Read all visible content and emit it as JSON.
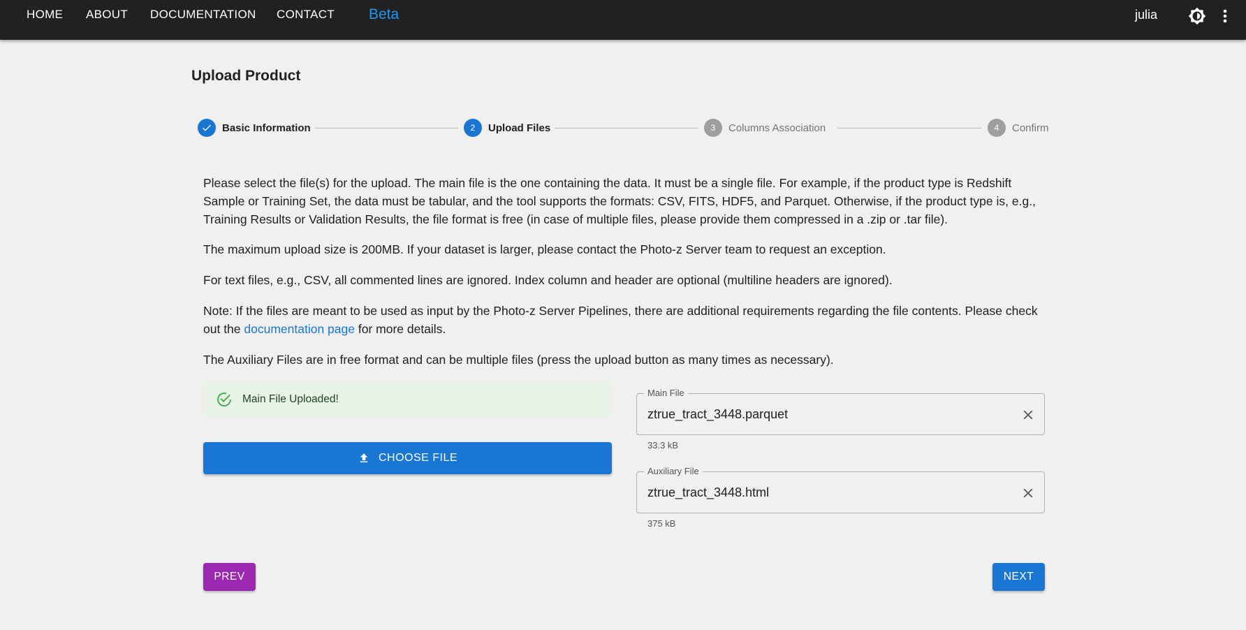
{
  "nav": {
    "items": [
      "HOME",
      "ABOUT",
      "DOCUMENTATION",
      "CONTACT"
    ],
    "beta_label": "Beta",
    "user": "julia",
    "icons": {
      "theme": "brightness-icon",
      "menu": "more-vert-icon"
    }
  },
  "page": {
    "title": "Upload Product"
  },
  "stepper": {
    "steps": [
      {
        "number": "1",
        "label": "Basic Information",
        "state": "completed"
      },
      {
        "number": "2",
        "label": "Upload Files",
        "state": "active"
      },
      {
        "number": "3",
        "label": "Columns Association",
        "state": "inactive"
      },
      {
        "number": "4",
        "label": "Confirm",
        "state": "inactive"
      }
    ],
    "colors": {
      "active": "#1976d2",
      "inactive": "#9e9e9e"
    }
  },
  "content": {
    "p1": "Please select the file(s) for the upload. The main file is the one containing the data. It must be a single file. For example, if the product type is Redshift Sample or Training Set, the data must be tabular, and the tool supports the formats: CSV, FITS, HDF5, and Parquet. Otherwise, if the product type is, e.g., Training Results or Validation Results, the file format is free (in case of multiple files, please provide them compressed in a .zip or .tar file).",
    "p2": "The maximum upload size is 200MB. If your dataset is larger, please contact the Photo-z Server team to request an exception.",
    "p3": "For text files, e.g., CSV, all commented lines are ignored. Index column and header are optional (multiline headers are ignored).",
    "p4_before": "Note: If the files are meant to be used as input by the Photo-z Server Pipelines, there are additional requirements regarding the file contents. Please check out the ",
    "p4_link": "documentation page",
    "p4_after": " for more details.",
    "p5": "The Auxiliary Files are in free format and can be multiple files (press the upload button as many times as necessary)."
  },
  "upload": {
    "alert_text": "Main File Uploaded!",
    "choose_button": "CHOOSE FILE",
    "main_file": {
      "label": "Main File",
      "value": "ztrue_tract_3448.parquet",
      "size": "33.3 kB"
    },
    "aux_file": {
      "label": "Auxiliary File",
      "value": "ztrue_tract_3448.html",
      "size": "375 kB"
    }
  },
  "buttons": {
    "prev": "PREV",
    "next": "NEXT"
  },
  "colors": {
    "primary": "#1976d2",
    "secondary": "#9c27b0",
    "success_bg": "#e8f3e8",
    "success": "#4caf50",
    "appbar": "#212121"
  }
}
